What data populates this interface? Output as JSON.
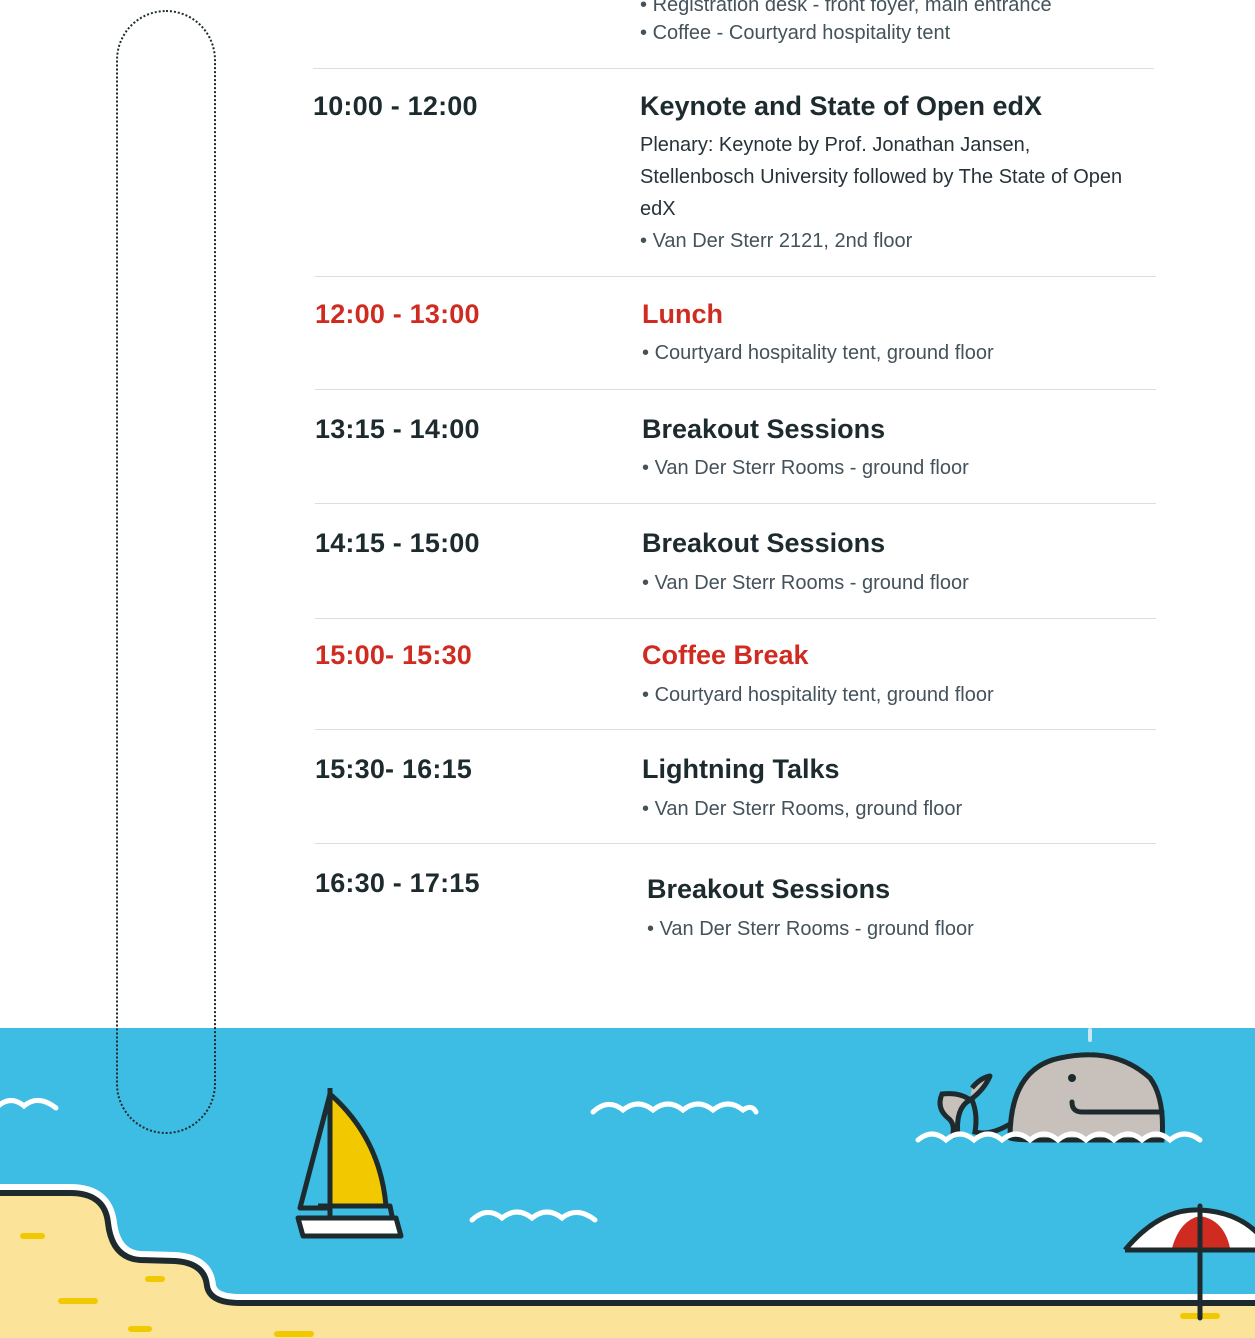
{
  "top": {
    "items": [
      "Registration desk - front foyer, main entrance",
      "Coffee - Courtyard hospitality tent"
    ]
  },
  "sessions": [
    {
      "time": "10:00 - 12:00",
      "title": "Keynote and State of Open edX",
      "description": "Plenary: Keynote by Prof. Jonathan Jansen, Stellenbosch University followed by The State of Open edX",
      "location": "Van Der Sterr 2121, 2nd floor"
    },
    {
      "time": "12:00 - 13:00",
      "title": "Lunch",
      "location": "Courtyard hospitality tent, ground floor"
    },
    {
      "time": "13:15 - 14:00",
      "title": "Breakout Sessions",
      "location": "Van Der Sterr Rooms - ground floor"
    },
    {
      "time": "14:15 - 15:00",
      "title": "Breakout Sessions",
      "location": "Van Der Sterr Rooms - ground floor"
    },
    {
      "time": "15:00- 15:30",
      "title": "Coffee Break",
      "location": "Courtyard hospitality tent, ground floor"
    },
    {
      "time": "15:30- 16:15",
      "title": "Lightning Talks",
      "location": "Van Der Sterr Rooms, ground floor"
    },
    {
      "time": "16:30 - 17:15",
      "title": "Breakout Sessions",
      "location": "Van Der Sterr Rooms - ground floor"
    }
  ],
  "colors": {
    "accent_red": "#d02b20",
    "ink": "#1d2b2f",
    "sea": "#3dbde3",
    "sand": "#fbe49a",
    "sail": "#f2c900",
    "whale": "#c8c0bb"
  },
  "icons": [
    "sailboat-icon",
    "whale-icon",
    "beach-umbrella-icon",
    "wave-icon"
  ]
}
